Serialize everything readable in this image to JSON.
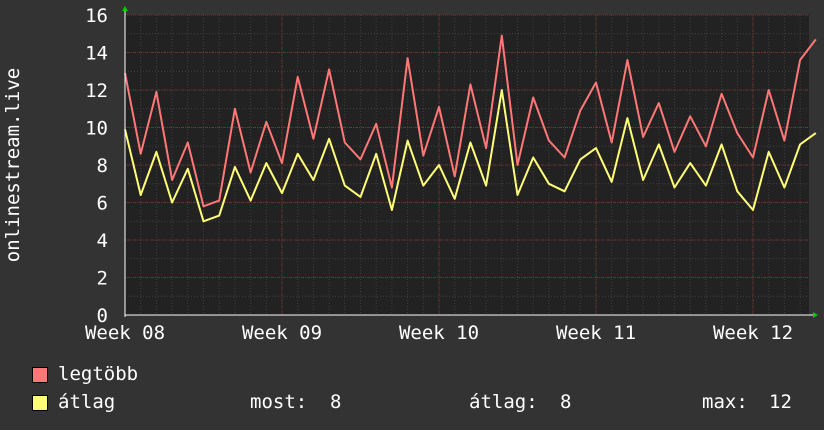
{
  "chart_data": {
    "type": "line",
    "ylabel": "onlinestream.live",
    "ylim": [
      0,
      16
    ],
    "yticks": [
      0,
      2,
      4,
      6,
      8,
      10,
      12,
      14,
      16
    ],
    "xlim": [
      0,
      4.4
    ],
    "xticks": [
      {
        "label": "Week 08",
        "value": 0
      },
      {
        "label": "Week 09",
        "value": 1
      },
      {
        "label": "Week 10",
        "value": 2
      },
      {
        "label": "Week 11",
        "value": 3
      },
      {
        "label": "Week 12",
        "value": 4
      }
    ],
    "grid": true,
    "series": [
      {
        "name": "legtöbb",
        "color": "#ff7777",
        "x": [
          0.0,
          0.1,
          0.2,
          0.3,
          0.4,
          0.5,
          0.6,
          0.7,
          0.8,
          0.9,
          1.0,
          1.1,
          1.2,
          1.3,
          1.4,
          1.5,
          1.6,
          1.7,
          1.8,
          1.9,
          2.0,
          2.1,
          2.2,
          2.3,
          2.4,
          2.5,
          2.6,
          2.7,
          2.8,
          2.9,
          3.0,
          3.1,
          3.2,
          3.3,
          3.4,
          3.5,
          3.6,
          3.7,
          3.8,
          3.9,
          4.0,
          4.1,
          4.2,
          4.3,
          4.4
        ],
        "values": [
          12.9,
          8.6,
          11.9,
          7.2,
          9.2,
          5.8,
          6.1,
          11.0,
          7.6,
          10.3,
          8.1,
          12.7,
          9.4,
          13.1,
          9.2,
          8.3,
          10.2,
          6.8,
          13.7,
          8.5,
          11.1,
          7.4,
          12.3,
          8.9,
          14.9,
          8.0,
          11.6,
          9.3,
          8.4,
          10.9,
          12.4,
          9.2,
          13.6,
          9.5,
          11.3,
          8.7,
          10.6,
          9.0,
          11.8,
          9.7,
          8.4,
          12.0,
          9.3,
          13.6,
          14.7
        ]
      },
      {
        "name": "átlag",
        "color": "#ffff77",
        "x": [
          0.0,
          0.1,
          0.2,
          0.3,
          0.4,
          0.5,
          0.6,
          0.7,
          0.8,
          0.9,
          1.0,
          1.1,
          1.2,
          1.3,
          1.4,
          1.5,
          1.6,
          1.7,
          1.8,
          1.9,
          2.0,
          2.1,
          2.2,
          2.3,
          2.4,
          2.5,
          2.6,
          2.7,
          2.8,
          2.9,
          3.0,
          3.1,
          3.2,
          3.3,
          3.4,
          3.5,
          3.6,
          3.7,
          3.8,
          3.9,
          4.0,
          4.1,
          4.2,
          4.3,
          4.4
        ],
        "values": [
          9.9,
          6.4,
          8.7,
          6.0,
          7.8,
          5.0,
          5.3,
          7.9,
          6.1,
          8.1,
          6.5,
          8.6,
          7.2,
          9.4,
          6.9,
          6.3,
          8.6,
          5.6,
          9.3,
          6.9,
          8.0,
          6.2,
          9.2,
          6.9,
          12.0,
          6.4,
          8.4,
          7.0,
          6.6,
          8.3,
          8.9,
          7.1,
          10.5,
          7.2,
          9.1,
          6.8,
          8.1,
          6.9,
          9.1,
          6.6,
          5.6,
          8.7,
          6.8,
          9.1,
          9.7
        ]
      }
    ]
  },
  "legend": [
    {
      "name": "legtöbb",
      "color": "#ff7777"
    },
    {
      "name": "átlag",
      "color": "#ffff77"
    }
  ],
  "stats": {
    "now_label": "most:",
    "now_value": "8",
    "avg_label": "átlag:",
    "avg_value": "8",
    "max_label": "max:",
    "max_value": "12"
  },
  "colors": {
    "background": "#333333",
    "plot_background": "#222222",
    "grid_minor": "#3f3f3f",
    "grid_major": "#7a3030",
    "axis": "#ffffff",
    "arrow": "#00cc00"
  }
}
